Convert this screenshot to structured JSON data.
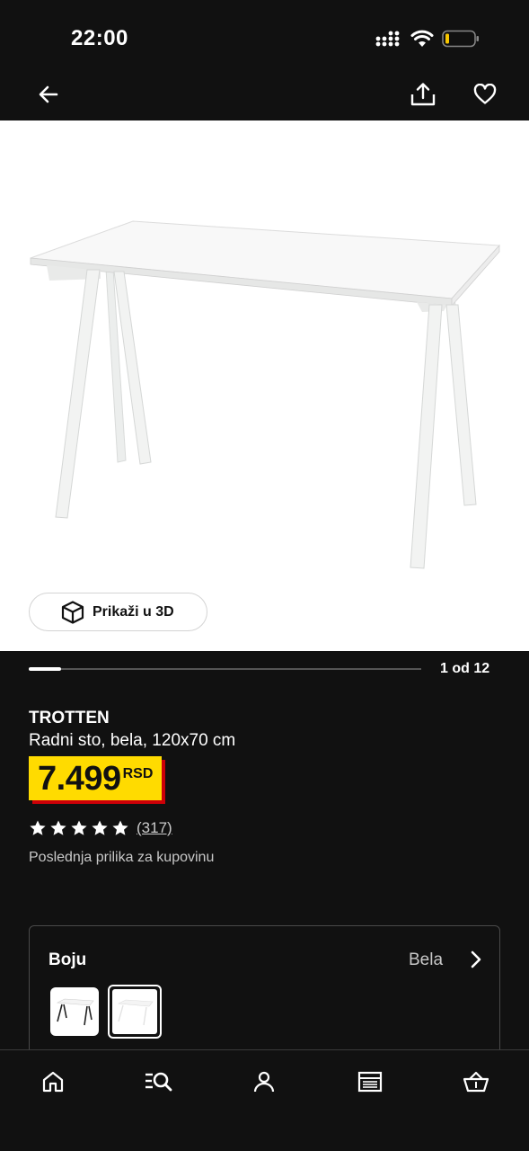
{
  "status_bar": {
    "time": "22:00"
  },
  "top_bar": {
    "back_icon": "arrow-left-icon",
    "share_icon": "share-icon",
    "favorite_icon": "heart-icon"
  },
  "gallery": {
    "view_3d_label": "Prikaži u 3D",
    "page_indicator": "1 od 12",
    "progress_fraction": 0.0833
  },
  "product": {
    "name": "TROTTEN",
    "description": "Radni sto, bela, 120x70 cm",
    "price": "7.499",
    "currency": "RSD",
    "rating_stars": 5,
    "rating_count": "(317)",
    "availability": "Poslednja prilika za kupovinu"
  },
  "color_selector": {
    "label": "Boju",
    "selected_value": "Bela",
    "options_count": 2,
    "selected_index": 1
  },
  "colors": {
    "price_yellow": "#ffdb00",
    "price_shadow_red": "#cc0008",
    "background": "#111111"
  },
  "bottom_nav": {
    "items": [
      "home-icon",
      "search-icon",
      "profile-icon",
      "store-icon",
      "cart-icon"
    ],
    "active": "search-icon"
  }
}
